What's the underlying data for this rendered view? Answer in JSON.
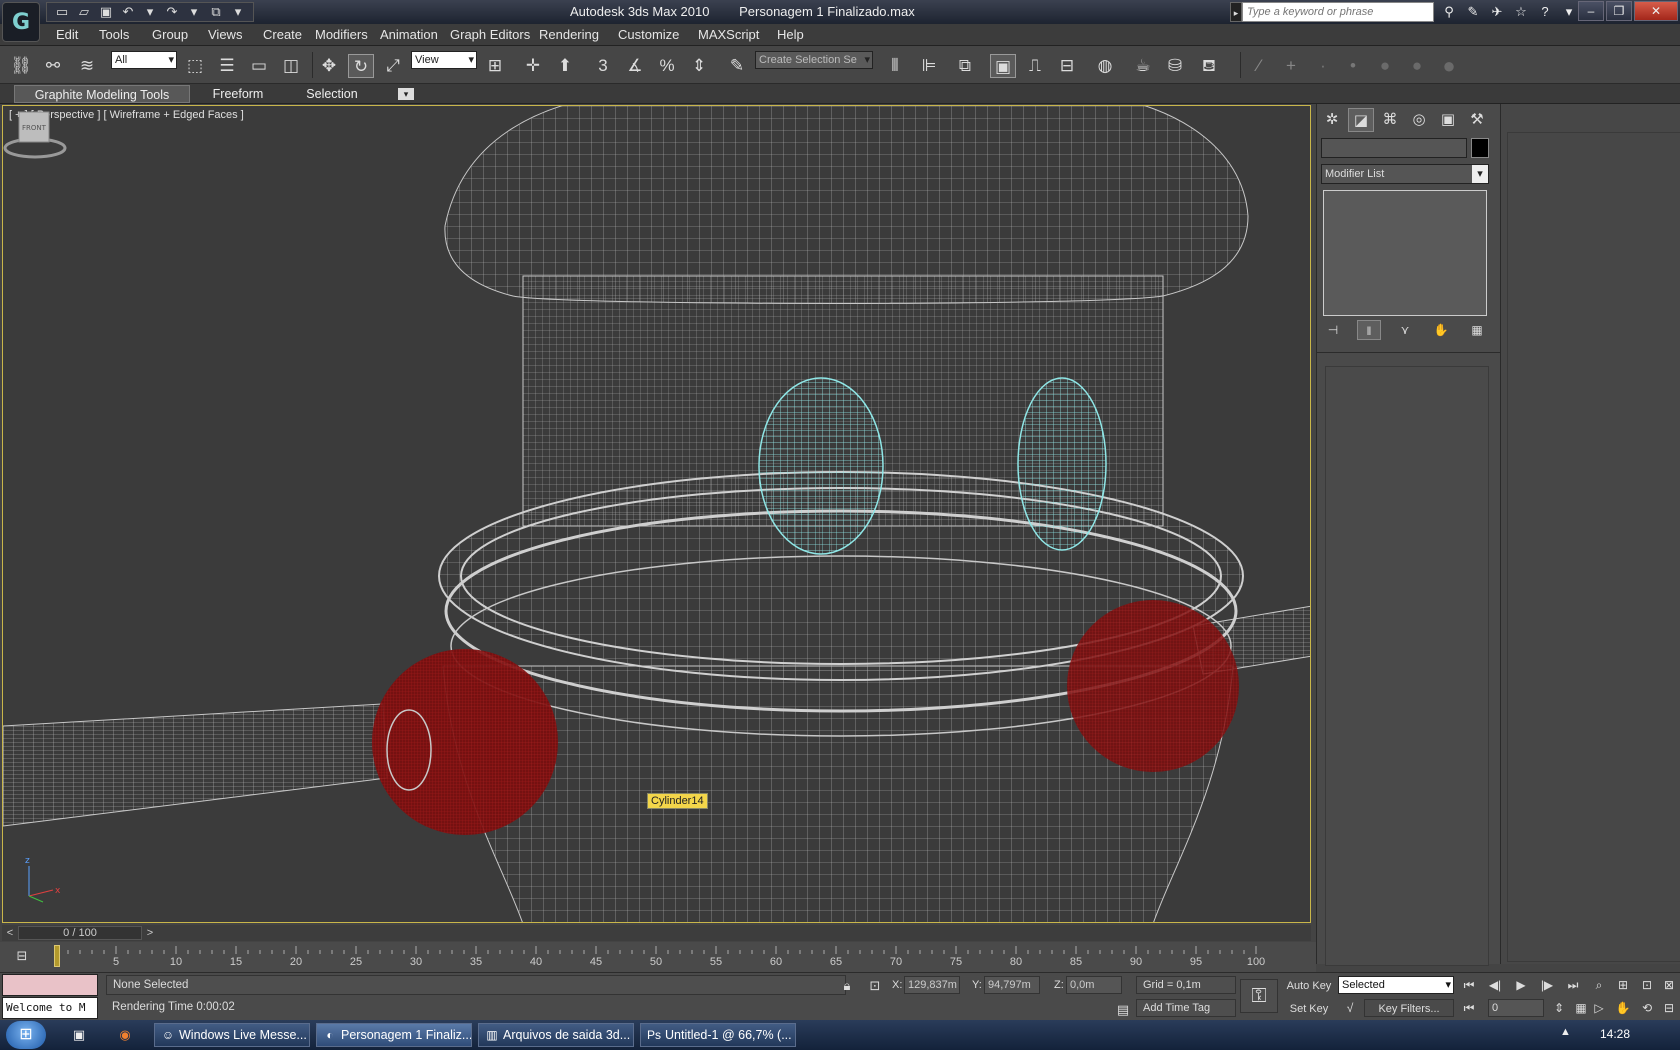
{
  "titlebar": {
    "app_name": "Autodesk 3ds Max  2010",
    "file_name": "Personagem 1 Finalizado.max",
    "search_placeholder": "Type a keyword or phrase"
  },
  "menubar": {
    "items": [
      "Edit",
      "Tools",
      "Group",
      "Views",
      "Create",
      "Modifiers",
      "Animation",
      "Graph Editors",
      "Rendering",
      "Customize",
      "MAXScript",
      "Help"
    ]
  },
  "toolbar": {
    "selection_filter": "All",
    "reference_coord": "View",
    "named_selection": "Create Selection Se"
  },
  "ribbon": {
    "tabs": [
      "Graphite Modeling Tools",
      "Freeform",
      "Selection"
    ]
  },
  "viewport": {
    "label": "[ + ] [ Perspective ] [ Wireframe + Edged Faces ]",
    "tooltip": "Cylinder14",
    "viewcube_face": "FRONT"
  },
  "command_panel": {
    "modifier_list": "Modifier List"
  },
  "timeline": {
    "slider_text": "0 / 100",
    "ticks": [
      "5",
      "10",
      "15",
      "20",
      "25",
      "30",
      "35",
      "40",
      "45",
      "50",
      "55",
      "60",
      "65",
      "70",
      "75",
      "80",
      "85",
      "90",
      "95",
      "100"
    ]
  },
  "status": {
    "maxscript_text": "Welcome to M",
    "selection_status": "None Selected",
    "rendering_time": "Rendering Time  0:00:02",
    "x_label": "X:",
    "x_value": "129,837m",
    "y_label": "Y:",
    "y_value": "94,797m",
    "z_label": "Z:",
    "z_value": "0,0m",
    "grid": "Grid = 0,1m",
    "add_time_tag": "Add Time Tag",
    "auto_key": "Auto Key",
    "set_key": "Set Key",
    "key_mode": "Selected",
    "key_filters": "Key Filters...",
    "current_frame": "0"
  },
  "taskbar": {
    "tasks": [
      "Windows Live Messe...",
      "Personagem 1 Finaliz...",
      "Arquivos de saida 3d...",
      "Untitled-1 @ 66,7% (..."
    ],
    "clock": "14:28"
  },
  "colors": {
    "viewport_border": "#c9b64a",
    "wireframe": "#bdbdbd",
    "selected_cyan": "#7fe0e0",
    "red_object": "#9a1010",
    "tooltip_bg": "#f3d64a"
  }
}
